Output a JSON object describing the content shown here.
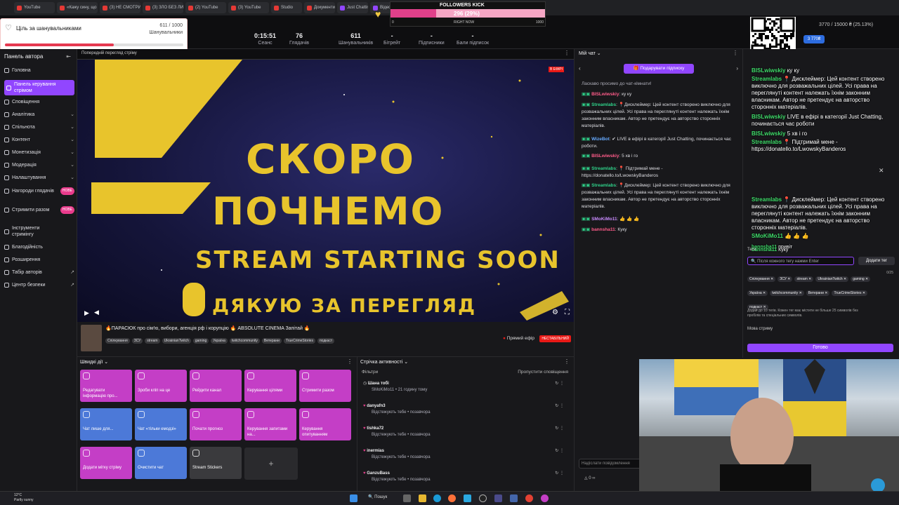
{
  "browser": {
    "tabs": [
      {
        "label": "YouTube",
        "icon": "youtube-icon"
      },
      {
        "label": "«Кажу сину, що в...",
        "icon": "youtube-icon"
      },
      {
        "label": "(3) НЕ СМОТРИ!",
        "icon": "youtube-icon"
      },
      {
        "label": "(3) ЗЛО БЕЗ ЛИ...",
        "icon": "youtube-icon"
      },
      {
        "label": "(2) YouTube",
        "icon": "youtube-icon"
      },
      {
        "label": "(3) YouTube",
        "icon": "youtube-icon"
      },
      {
        "label": "Studio",
        "icon": "youtube-icon"
      },
      {
        "label": "Документи і посиланн",
        "icon": "doc-icon"
      },
      {
        "label": "Just Chatting Str...",
        "icon": "twitch-icon"
      },
      {
        "label": "Відео BISLwiskiy",
        "icon": "twitch-icon"
      },
      {
        "label": "Twitch",
        "icon": "twitch-icon"
      },
      {
        "label": "Twitch",
        "icon": "twitch-icon"
      },
      {
        "label": "Donatello",
        "icon": "donate-icon"
      },
      {
        "label": "Films",
        "icon": "film-icon"
      },
      {
        "label": "DeepState",
        "icon": "map-icon"
      }
    ]
  },
  "followers_widget": {
    "title": "FOLLOWERS KICK",
    "count": "296 (29%)",
    "min": "0",
    "max": "1000",
    "label": "RIGHT NOW",
    "fraction": 0.296
  },
  "goal": {
    "title": "Ціль за шанувальниками",
    "value": "611 / 1000",
    "unit": "Шанувальники",
    "fraction": 0.611
  },
  "stats": [
    {
      "value": "0:15:51",
      "label": "Сеанс"
    },
    {
      "value": "76",
      "label": "Глядачів"
    },
    {
      "value": "611",
      "label": "Шанувальників"
    },
    {
      "value": "-",
      "label": "Бітрейт"
    },
    {
      "value": "-",
      "label": "Підписники"
    },
    {
      "value": "-",
      "label": "Бали підписок"
    }
  ],
  "donation_top": {
    "text": "3770 / 15000 ₴ (25.13%)",
    "button": "3 770₴"
  },
  "sidebar": {
    "title": "Панель автора",
    "items": [
      {
        "label": "Головна",
        "icon": "home-icon",
        "chevron": false
      },
      {
        "label": "Панель керування стрімом",
        "icon": "dashboard-icon",
        "chevron": false,
        "active": true
      },
      {
        "label": "Сповіщення",
        "icon": "bell-icon",
        "chevron": false
      },
      {
        "label": "Аналітика",
        "icon": "chart-icon",
        "chevron": true
      },
      {
        "label": "Спільнота",
        "icon": "community-icon",
        "chevron": true
      },
      {
        "label": "Контент",
        "icon": "content-icon",
        "chevron": true
      },
      {
        "label": "Монетизація",
        "icon": "money-icon",
        "chevron": true
      },
      {
        "label": "Модерація",
        "icon": "shield-icon",
        "chevron": true
      },
      {
        "label": "Налаштування",
        "icon": "gear-icon",
        "chevron": true
      },
      {
        "label": "Нагороди глядачів",
        "icon": "gift-icon",
        "badge": "НОВЕ"
      },
      {
        "label": "Стримити разом",
        "icon": "people-icon",
        "badge": "НОВЕ"
      },
      {
        "label": "Інструменти стримінгу",
        "icon": "tools-icon",
        "chevron": false
      },
      {
        "label": "Благодійність",
        "icon": "charity-icon",
        "chevron": false
      },
      {
        "label": "Розширення",
        "icon": "extension-icon",
        "chevron": false
      },
      {
        "label": "Табір авторів",
        "icon": "camp-icon",
        "external": true
      },
      {
        "label": "Центр безпеки",
        "icon": "safety-icon",
        "external": true
      }
    ]
  },
  "player": {
    "header": "Попередній перегляд стріму",
    "live_badge": "В ЕФІРІ",
    "line1": "СКОРО",
    "line2": "ПОЧНЕМО",
    "line3": "STREAM STARTING SOON",
    "line4": "ДЯКУЮ ЗА ПЕРЕГЛЯД"
  },
  "stream_info": {
    "title": "🔥ПАРАСЮК про сім'ю, вибори, агенція рф і корупцію 🔥 ABSOLUTE CINEMA Запітай 🔥",
    "tags": [
      "Спілкування",
      "ЗСУ",
      "stream",
      "UkrainianTwitch",
      "gaming",
      "Україна",
      "twitchcommunity",
      "Ветерани",
      "TrueCrimeStories",
      "подкаст"
    ],
    "status": "Прямий ефір",
    "stability": "НЕСТАБІЛЬНИЙ"
  },
  "quick_actions": {
    "title": "Швидкі дії",
    "items": [
      {
        "label": "Редагувати інформацію про...",
        "color": "pink",
        "icon": "pencil-icon"
      },
      {
        "label": "Зроби кліп на це",
        "color": "pink",
        "icon": "clip-icon"
      },
      {
        "label": "Рейдити канал",
        "color": "pink",
        "icon": "raid-icon"
      },
      {
        "label": "Керування цілями",
        "color": "pink",
        "icon": "star-icon"
      },
      {
        "label": "Стримити разом",
        "color": "pink",
        "icon": "people-icon"
      },
      {
        "label": "Чат лише для...",
        "color": "blue",
        "icon": "star-icon"
      },
      {
        "label": "Чат «тільки емодзі»",
        "color": "blue",
        "icon": "emoji-icon"
      },
      {
        "label": "Почати прогноз",
        "color": "pink",
        "icon": "prediction-icon"
      },
      {
        "label": "Керування запитами на...",
        "color": "pink",
        "icon": "request-icon"
      },
      {
        "label": "Керування опитуванням",
        "color": "pink",
        "icon": "poll-icon"
      },
      {
        "label": "Додати мітку стріму",
        "color": "pink",
        "icon": "marker-icon"
      },
      {
        "label": "Очистити чат",
        "color": "blue",
        "icon": "clear-icon"
      },
      {
        "label": "Stream Stickers",
        "color": "gray",
        "icon": "heart-icon"
      }
    ]
  },
  "activity": {
    "title": "Стрічка активності",
    "filters": "Фільтри",
    "skip": "Пропустити сповіщення",
    "items": [
      {
        "name": "Шана тобі",
        "sub": "SMoKiMo11 • 21 годину тому",
        "icon": "clock-icon"
      },
      {
        "name": "danyafn3",
        "sub": "Відстежують тебе • позавчора",
        "icon": "heart-icon"
      },
      {
        "name": "tishka72",
        "sub": "Відстежують тебе • позавчора",
        "icon": "heart-icon"
      },
      {
        "name": "inermias",
        "sub": "Відстежують тебе • позавчора",
        "icon": "heart-icon"
      },
      {
        "name": "GanzuBass",
        "sub": "Відстежують тебе • позавчора",
        "icon": "heart-icon"
      }
    ]
  },
  "chat": {
    "title": "Мій чат",
    "gift_button": "Подарувати підписку",
    "welcome": "Ласкаво просимо до чат-кімнати!",
    "messages": [
      {
        "user": "BISLwiwskiy",
        "color": "#ff5c8a",
        "text": ": ку ку"
      },
      {
        "user": "Streamlabs",
        "color": "#2fd38a",
        "text": ": 📍Дисклеймер: Цей контент створено виключно для розважальних цілей. Усі права на переглянуті контент належать їхнім законним власникам. Автор не претендує на авторство сторонніх матеріалів."
      },
      {
        "user": "WizeBot",
        "color": "#66aaff",
        "text": ": ✔ LIVE в ефірі в категорії Just Chatting, починається час роботи."
      },
      {
        "user": "BISLwiwskiy",
        "color": "#ff5c8a",
        "text": ": 5 хв і го"
      },
      {
        "user": "Streamlabs",
        "color": "#2fd38a",
        "text": ": 📍 Підтримай мене - https://donatello.to/LwowskyBanderos"
      },
      {
        "user": "Streamlabs",
        "color": "#2fd38a",
        "text": ": 📍Дисклеймер: Цей контент створено виключно для розважальних цілей. Усі права на переглянуті контент належать їхнім законним власникам. Автор не претендує на авторство сторонніх матеріалів."
      },
      {
        "user": "SMoKiMo11",
        "color": "#c98bff",
        "text": ": 👍 👍 👍"
      },
      {
        "user": "bannsha11",
        "color": "#ff5c8a",
        "text": ": Куку"
      }
    ],
    "input_placeholder": "Надіслати повідомлення"
  },
  "right_panel": {
    "overlay_messages": [
      {
        "user": "BISLwiwskiy",
        "text": "ку ку"
      },
      {
        "user": "Streamlabs",
        "text": "📍 Дисклеймер: Цей контент створено виключно для розважальних цілей. Усі права на переглянуті контент належать їхнім законним власникам. Автор не претендує на авторство сторонніх матеріалів."
      },
      {
        "user": "BISLwiwskiy",
        "text": "LIVE в ефірі в категорії Just Chatting, починається час роботи"
      },
      {
        "user": "BISLwiwskiy",
        "text": "5 хв і го"
      },
      {
        "user": "Streamlabs",
        "text": "📍 Підтримай мене - https://donatello.to/LwowskyBanderos"
      },
      {
        "user": "Streamlabs",
        "text": "📍 Дисклеймер: Цей контент створено виключно для розважальних цілей. Усі права на переглянуті контент належать їхнім законним власникам. Автор не претендує на авторство сторонніх матеріалів."
      },
      {
        "user": "SMoKiMo11",
        "text": "👍 👍 👍"
      },
      {
        "user": "bannsha11",
        "text": "привіт"
      },
      {
        "user": "bannsha11",
        "text": "Куку"
      }
    ],
    "tags_label": "Теги",
    "tag_placeholder": "Після кожного тегу нажми Enter",
    "add_tag": "Додати тег",
    "tag_count": "0/25",
    "tags": [
      "Спілкування",
      "ЗСУ",
      "stream",
      "UkrainianTwitch",
      "gaming",
      "Україна",
      "twitchcommunity",
      "Ветерани",
      "TrueCrimeStories",
      "подкаст"
    ],
    "tags_hint": "Додай до 10 тегів. Кожен тег має містити не більше 25 символів без пробілів та спеціальних символів.",
    "language_label": "Мова стриму",
    "done": "Готово"
  },
  "taskbar": {
    "weather_temp": "12°C",
    "weather_text": "Partly sunny",
    "search": "Пошук"
  }
}
